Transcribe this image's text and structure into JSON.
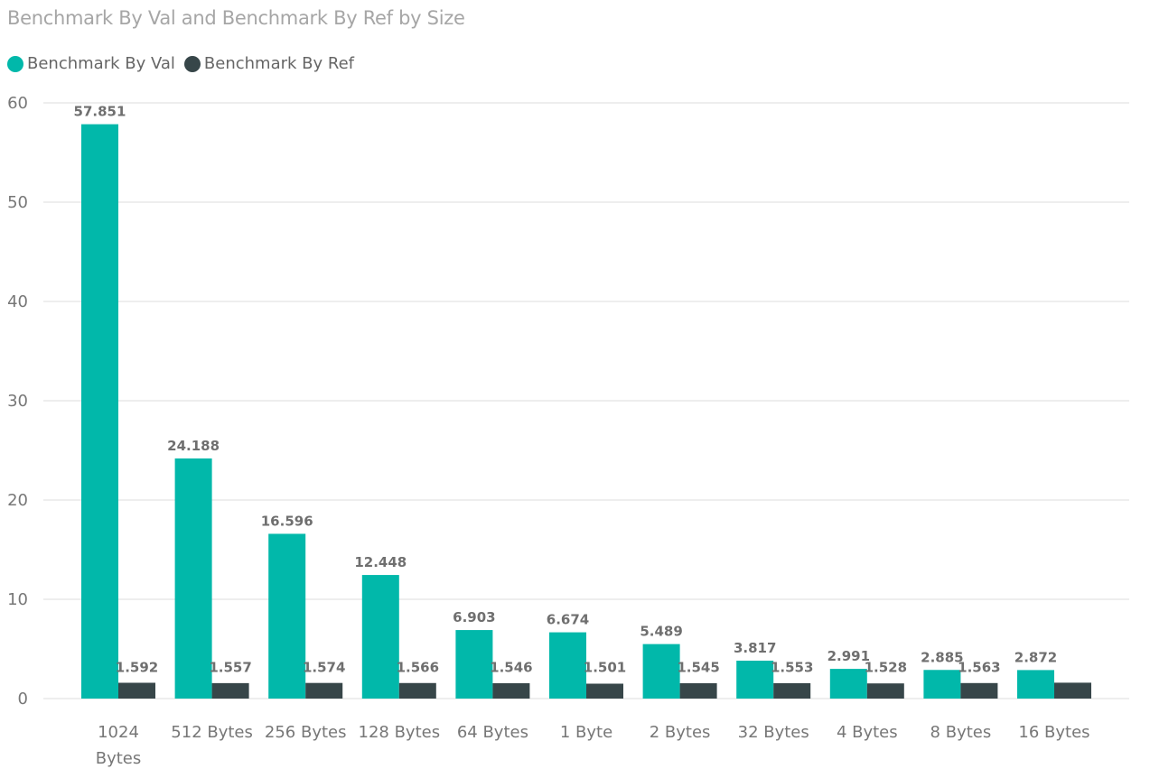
{
  "chart_data": {
    "type": "bar",
    "title": "Benchmark By Val and Benchmark By Ref by Size",
    "xlabel": "",
    "ylabel": "",
    "ylim": [
      0,
      60
    ],
    "yticks": [
      0,
      10,
      20,
      30,
      40,
      50,
      60
    ],
    "grid": true,
    "legend_position": "top-left",
    "categories": [
      "1024 Bytes",
      "512 Bytes",
      "256 Bytes",
      "128 Bytes",
      "64 Bytes",
      "1 Byte",
      "2 Bytes",
      "32 Bytes",
      "4 Bytes",
      "8 Bytes",
      "16 Bytes"
    ],
    "category_lines": [
      [
        "1024",
        "Bytes"
      ],
      [
        "512 Bytes"
      ],
      [
        "256 Bytes"
      ],
      [
        "128 Bytes"
      ],
      [
        "64 Bytes"
      ],
      [
        "1 Byte"
      ],
      [
        "2 Bytes"
      ],
      [
        "32 Bytes"
      ],
      [
        "4 Bytes"
      ],
      [
        "8 Bytes"
      ],
      [
        "16 Bytes"
      ]
    ],
    "series": [
      {
        "name": "Benchmark By Val",
        "color": "#01b8aa",
        "values": [
          57.851,
          24.188,
          16.596,
          12.448,
          6.903,
          6.674,
          5.489,
          3.817,
          2.991,
          2.885,
          2.872
        ],
        "labels": [
          "57.851",
          "24.188",
          "16.596",
          "12.448",
          "6.903",
          "6.674",
          "5.489",
          "3.817",
          "2.991",
          "2.885",
          "2.872"
        ]
      },
      {
        "name": "Benchmark By Ref",
        "color": "#374649",
        "values": [
          1.592,
          1.557,
          1.574,
          1.566,
          1.546,
          1.501,
          1.545,
          1.553,
          1.528,
          1.563,
          1.6
        ],
        "labels": [
          "1.592",
          "1.557",
          "1.574",
          "1.566",
          "1.546",
          "1.501",
          "1.545",
          "1.553",
          "1.528",
          "1.563",
          ""
        ]
      }
    ]
  }
}
